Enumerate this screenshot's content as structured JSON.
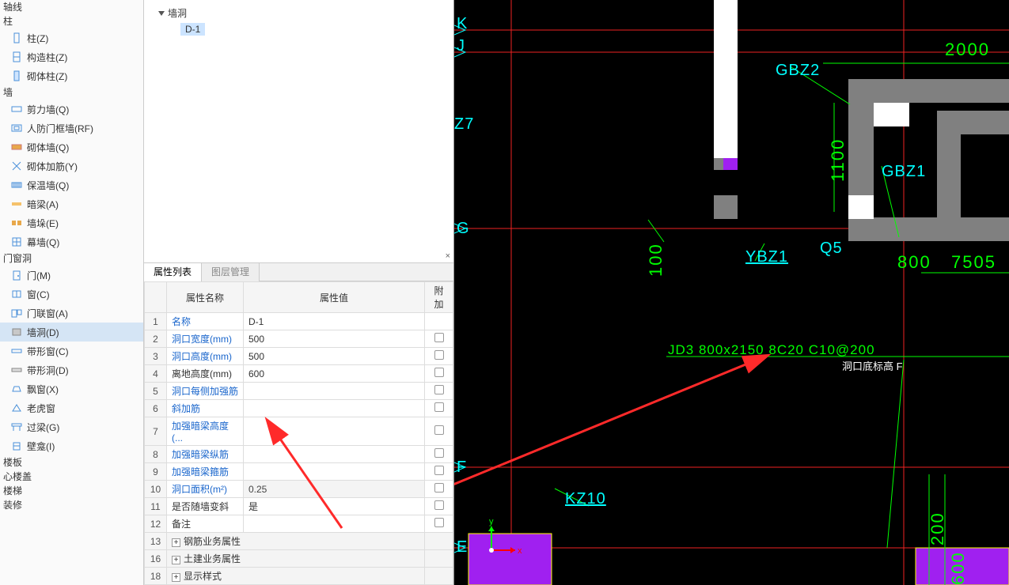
{
  "nav": {
    "header": "",
    "top_items": [
      {
        "label": "轴线",
        "kind": "group"
      }
    ],
    "z_group_title": "柱",
    "z_items": [
      {
        "label": "柱(Z)",
        "icon": "column"
      },
      {
        "label": "构造柱(Z)",
        "icon": "struct-column"
      },
      {
        "label": "砌体柱(Z)",
        "icon": "mason-column"
      }
    ],
    "q_group_title": "墙",
    "q_items": [
      {
        "label": "剪力墙(Q)",
        "icon": "shear-wall"
      },
      {
        "label": "人防门框墙(RF)",
        "icon": "frame-wall"
      },
      {
        "label": "砌体墙(Q)",
        "icon": "mason-wall"
      },
      {
        "label": "砌体加筋(Y)",
        "icon": "rebar"
      },
      {
        "label": "保温墙(Q)",
        "icon": "insulation"
      },
      {
        "label": "暗梁(A)",
        "icon": "hidden-beam"
      },
      {
        "label": "墙垛(E)",
        "icon": "pier"
      },
      {
        "label": "幕墙(Q)",
        "icon": "curtain"
      }
    ],
    "d_group_title": "门窗洞",
    "d_items": [
      {
        "label": "门(M)",
        "icon": "door"
      },
      {
        "label": "窗(C)",
        "icon": "window"
      },
      {
        "label": "门联窗(A)",
        "icon": "door-window"
      },
      {
        "label": "墙洞(D)",
        "icon": "wall-hole",
        "selected": true
      },
      {
        "label": "带形窗(C)",
        "icon": "strip-window"
      },
      {
        "label": "带形洞(D)",
        "icon": "strip-hole"
      },
      {
        "label": "飘窗(X)",
        "icon": "bay-window"
      },
      {
        "label": "老虎窗",
        "icon": "dormer"
      },
      {
        "label": "过梁(G)",
        "icon": "lintel"
      },
      {
        "label": "壁龛(I)",
        "icon": "niche"
      }
    ],
    "bottom_groups": [
      "楼板",
      "心楼盖",
      "楼梯",
      "装修"
    ]
  },
  "tree": {
    "root": "墙洞",
    "child": "D-1"
  },
  "tabs": {
    "active": "属性列表",
    "inactive": "图层管理"
  },
  "prop_headers": {
    "name": "属性名称",
    "value": "属性值",
    "extra": "附加"
  },
  "props": [
    {
      "n": "1",
      "name": "名称",
      "value": "D-1",
      "blue": true,
      "cb": false
    },
    {
      "n": "2",
      "name": "洞口宽度(mm)",
      "value": "500",
      "blue": true,
      "cb": true
    },
    {
      "n": "3",
      "name": "洞口高度(mm)",
      "value": "500",
      "blue": true,
      "cb": true
    },
    {
      "n": "4",
      "name": "离地高度(mm)",
      "value": "600",
      "blue": false,
      "cb": true
    },
    {
      "n": "5",
      "name": "洞口每侧加强筋",
      "value": "",
      "blue": true,
      "cb": true
    },
    {
      "n": "6",
      "name": "斜加筋",
      "value": "",
      "blue": true,
      "cb": true
    },
    {
      "n": "7",
      "name": "加强暗梁高度(...",
      "value": "",
      "blue": true,
      "cb": true
    },
    {
      "n": "8",
      "name": "加强暗梁纵筋",
      "value": "",
      "blue": true,
      "cb": true
    },
    {
      "n": "9",
      "name": "加强暗梁箍筋",
      "value": "",
      "blue": true,
      "cb": true
    },
    {
      "n": "10",
      "name": "洞口面积(m²)",
      "value": "0.25",
      "blue": true,
      "readonly": true,
      "cb": true
    },
    {
      "n": "11",
      "name": "是否随墙变斜",
      "value": "是",
      "blue": false,
      "cb": true
    },
    {
      "n": "12",
      "name": "备注",
      "value": "",
      "blue": false,
      "cb": true
    },
    {
      "n": "13",
      "name": "钢筋业务属性",
      "value": "",
      "blue": false,
      "expander": true
    },
    {
      "n": "16",
      "name": "土建业务属性",
      "value": "",
      "blue": false,
      "expander": true
    },
    {
      "n": "18",
      "name": "显示样式",
      "value": "",
      "blue": false,
      "expander": true
    }
  ],
  "cad": {
    "labels": {
      "K": "K",
      "J": "J",
      "Z7": "Z7",
      "G": "G",
      "F": "F",
      "E": "E",
      "GBZ2": "GBZ2",
      "GBZ1": "GBZ1",
      "YBZ1": "YBZ1",
      "Q5": "Q5",
      "KZ10": "KZ10",
      "d2000": "2000",
      "d1100": "1100",
      "d800": "800",
      "d7505": "7505",
      "d100": "100",
      "d200": "200",
      "d600": "600",
      "jd3": "JD3 800x2150   8C20 C10@200",
      "note": "洞口底标高 F"
    }
  }
}
